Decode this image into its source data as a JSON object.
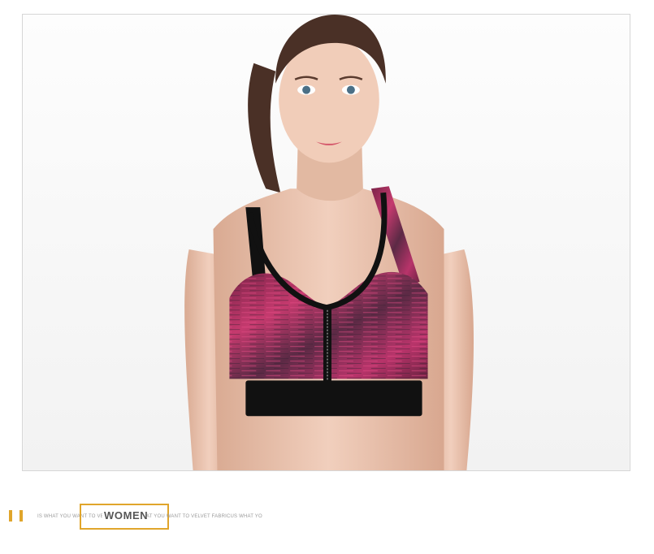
{
  "banner": {
    "category_label": "WOMEN",
    "tagline_left": "IS WHAT YOU WANT TO VEL",
    "tagline_right": "AT YOU WANT TO VELVET FABRICUS WHAT YO"
  },
  "colors": {
    "accent": "#e0a52b",
    "frame_border": "#d6d6d6",
    "bra_primary": "#b0305e",
    "bra_trim": "#111111",
    "skin": "#e9c4ae",
    "hair": "#4a3026"
  },
  "image": {
    "subject": "sports-bra-photo"
  }
}
